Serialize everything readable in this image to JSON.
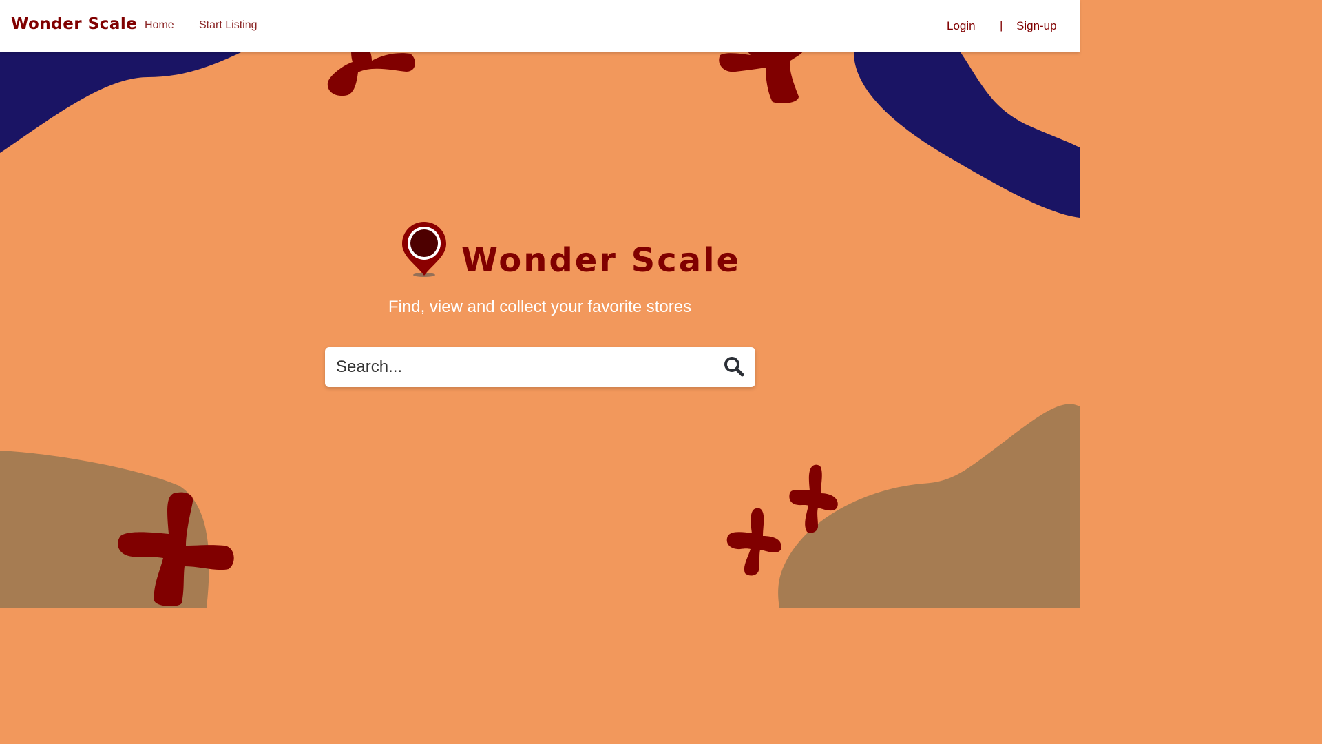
{
  "navbar": {
    "brand": "Wonder Scale",
    "links": [
      {
        "label": "Home"
      },
      {
        "label": "Start Listing"
      }
    ],
    "login": "Login",
    "separator": "|",
    "signup": "Sign-up"
  },
  "hero": {
    "title": "Wonder Scale",
    "subtitle": "Find, view and collect your favorite stores"
  },
  "search": {
    "placeholder": "Search...",
    "icon": "search-icon"
  },
  "colors": {
    "background": "#f2985c",
    "brand": "#800000",
    "navy": "#1a1464",
    "tan": "#a67c52"
  }
}
